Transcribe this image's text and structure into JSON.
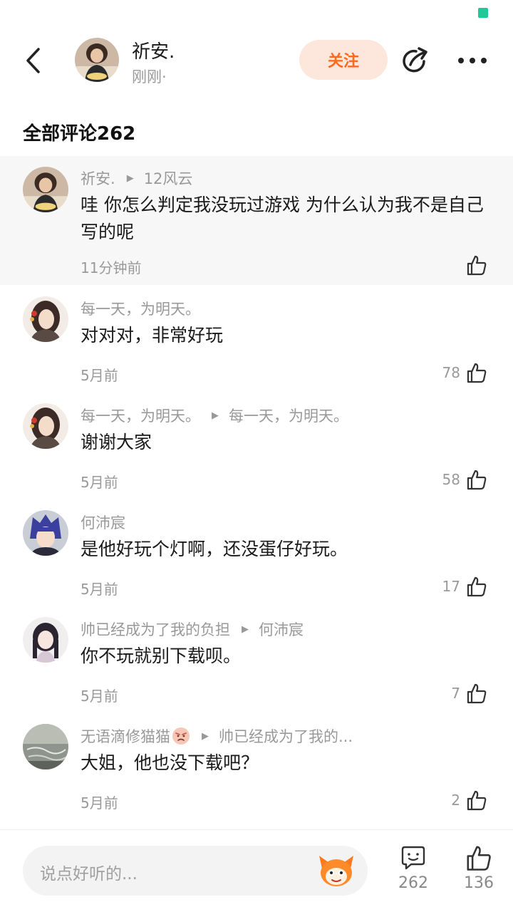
{
  "header": {
    "author_name": "祈安.",
    "author_time": "刚刚·",
    "follow_label": "关注"
  },
  "section_title": "全部评论262",
  "comments": [
    {
      "user": "祈安.",
      "reply_to": "12风云",
      "text": "哇 你怎么判定我没玩过游戏 为什么认为我不是自己写的呢",
      "time": "11分钟前",
      "likes": ""
    },
    {
      "user": "每一天，为明天。",
      "reply_to": "",
      "text": "对对对，非常好玩",
      "time": "5月前",
      "likes": "78"
    },
    {
      "user": "每一天，为明天。",
      "reply_to": "每一天，为明天。",
      "text": "谢谢大家",
      "time": "5月前",
      "likes": "58"
    },
    {
      "user": "何沛宸",
      "reply_to": "",
      "text": "是他好玩个灯啊，还没蛋仔好玩。",
      "time": "5月前",
      "likes": "17"
    },
    {
      "user": "帅已经成为了我的负担",
      "reply_to": "何沛宸",
      "text": "你不玩就别下载呗。",
      "time": "5月前",
      "likes": "7"
    },
    {
      "user": "无语滴修猫猫",
      "reply_to": "帅已经成为了我的...",
      "text": "大姐，他也没下载吧？",
      "time": "5月前",
      "likes": "2"
    }
  ],
  "bottom_bar": {
    "input_placeholder": "说点好听的...",
    "comment_count": "262",
    "like_count": "136"
  },
  "colors": {
    "accent": "#ff6a1f",
    "follow_bg": "#fde6dc",
    "status_green": "#20c997"
  }
}
